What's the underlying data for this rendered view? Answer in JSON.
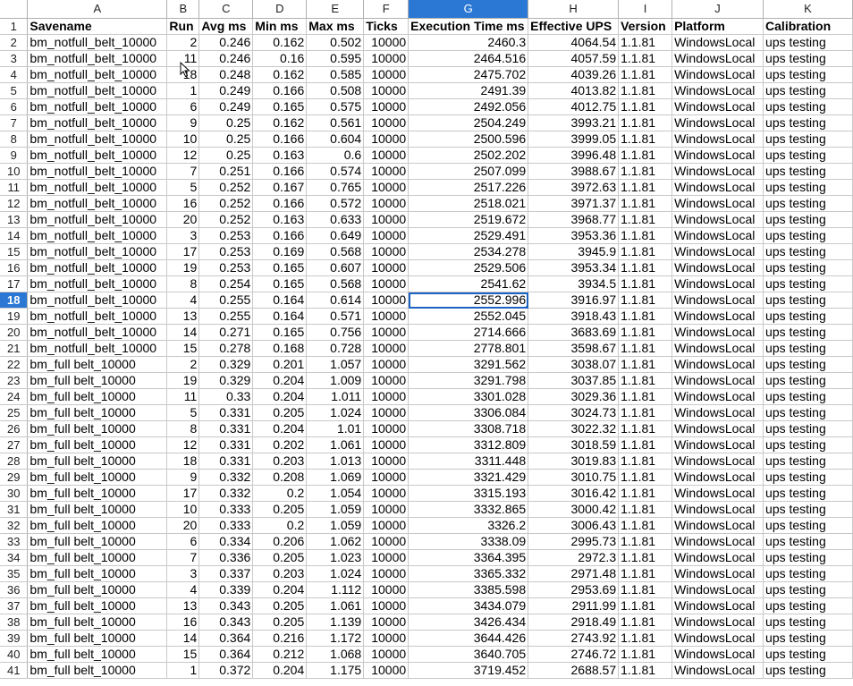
{
  "sheet": {
    "selected_cell": "G18",
    "selected_row": "18",
    "selected_col": "G",
    "columns": [
      "A",
      "B",
      "C",
      "D",
      "E",
      "F",
      "G",
      "H",
      "I",
      "J",
      "K"
    ],
    "col_align": [
      "txt",
      "num",
      "num",
      "num",
      "num",
      "num",
      "num",
      "num",
      "txt",
      "txt",
      "txt"
    ],
    "header_row": [
      "Savename",
      "Run",
      "Avg ms",
      "Min ms",
      "Max ms",
      "Ticks",
      "Execution Time ms",
      "Effective UPS",
      "Version",
      "Platform",
      "Calibration"
    ],
    "rows": [
      [
        "bm_notfull_belt_10000",
        "2",
        "0.246",
        "0.162",
        "0.502",
        "10000",
        "2460.3",
        "4064.54",
        "1.1.81",
        "WindowsLocal",
        "ups testing"
      ],
      [
        "bm_notfull_belt_10000",
        "11",
        "0.246",
        "0.16",
        "0.595",
        "10000",
        "2464.516",
        "4057.59",
        "1.1.81",
        "WindowsLocal",
        "ups testing"
      ],
      [
        "bm_notfull_belt_10000",
        "18",
        "0.248",
        "0.162",
        "0.585",
        "10000",
        "2475.702",
        "4039.26",
        "1.1.81",
        "WindowsLocal",
        "ups testing"
      ],
      [
        "bm_notfull_belt_10000",
        "1",
        "0.249",
        "0.166",
        "0.508",
        "10000",
        "2491.39",
        "4013.82",
        "1.1.81",
        "WindowsLocal",
        "ups testing"
      ],
      [
        "bm_notfull_belt_10000",
        "6",
        "0.249",
        "0.165",
        "0.575",
        "10000",
        "2492.056",
        "4012.75",
        "1.1.81",
        "WindowsLocal",
        "ups testing"
      ],
      [
        "bm_notfull_belt_10000",
        "9",
        "0.25",
        "0.162",
        "0.561",
        "10000",
        "2504.249",
        "3993.21",
        "1.1.81",
        "WindowsLocal",
        "ups testing"
      ],
      [
        "bm_notfull_belt_10000",
        "10",
        "0.25",
        "0.166",
        "0.604",
        "10000",
        "2500.596",
        "3999.05",
        "1.1.81",
        "WindowsLocal",
        "ups testing"
      ],
      [
        "bm_notfull_belt_10000",
        "12",
        "0.25",
        "0.163",
        "0.6",
        "10000",
        "2502.202",
        "3996.48",
        "1.1.81",
        "WindowsLocal",
        "ups testing"
      ],
      [
        "bm_notfull_belt_10000",
        "7",
        "0.251",
        "0.166",
        "0.574",
        "10000",
        "2507.099",
        "3988.67",
        "1.1.81",
        "WindowsLocal",
        "ups testing"
      ],
      [
        "bm_notfull_belt_10000",
        "5",
        "0.252",
        "0.167",
        "0.765",
        "10000",
        "2517.226",
        "3972.63",
        "1.1.81",
        "WindowsLocal",
        "ups testing"
      ],
      [
        "bm_notfull_belt_10000",
        "16",
        "0.252",
        "0.166",
        "0.572",
        "10000",
        "2518.021",
        "3971.37",
        "1.1.81",
        "WindowsLocal",
        "ups testing"
      ],
      [
        "bm_notfull_belt_10000",
        "20",
        "0.252",
        "0.163",
        "0.633",
        "10000",
        "2519.672",
        "3968.77",
        "1.1.81",
        "WindowsLocal",
        "ups testing"
      ],
      [
        "bm_notfull_belt_10000",
        "3",
        "0.253",
        "0.166",
        "0.649",
        "10000",
        "2529.491",
        "3953.36",
        "1.1.81",
        "WindowsLocal",
        "ups testing"
      ],
      [
        "bm_notfull_belt_10000",
        "17",
        "0.253",
        "0.169",
        "0.568",
        "10000",
        "2534.278",
        "3945.9",
        "1.1.81",
        "WindowsLocal",
        "ups testing"
      ],
      [
        "bm_notfull_belt_10000",
        "19",
        "0.253",
        "0.165",
        "0.607",
        "10000",
        "2529.506",
        "3953.34",
        "1.1.81",
        "WindowsLocal",
        "ups testing"
      ],
      [
        "bm_notfull_belt_10000",
        "8",
        "0.254",
        "0.165",
        "0.568",
        "10000",
        "2541.62",
        "3934.5",
        "1.1.81",
        "WindowsLocal",
        "ups testing"
      ],
      [
        "bm_notfull_belt_10000",
        "4",
        "0.255",
        "0.164",
        "0.614",
        "10000",
        "2552.996",
        "3916.97",
        "1.1.81",
        "WindowsLocal",
        "ups testing"
      ],
      [
        "bm_notfull_belt_10000",
        "13",
        "0.255",
        "0.164",
        "0.571",
        "10000",
        "2552.045",
        "3918.43",
        "1.1.81",
        "WindowsLocal",
        "ups testing"
      ],
      [
        "bm_notfull_belt_10000",
        "14",
        "0.271",
        "0.165",
        "0.756",
        "10000",
        "2714.666",
        "3683.69",
        "1.1.81",
        "WindowsLocal",
        "ups testing"
      ],
      [
        "bm_notfull_belt_10000",
        "15",
        "0.278",
        "0.168",
        "0.728",
        "10000",
        "2778.801",
        "3598.67",
        "1.1.81",
        "WindowsLocal",
        "ups testing"
      ],
      [
        "bm_full belt_10000",
        "2",
        "0.329",
        "0.201",
        "1.057",
        "10000",
        "3291.562",
        "3038.07",
        "1.1.81",
        "WindowsLocal",
        "ups testing"
      ],
      [
        "bm_full belt_10000",
        "19",
        "0.329",
        "0.204",
        "1.009",
        "10000",
        "3291.798",
        "3037.85",
        "1.1.81",
        "WindowsLocal",
        "ups testing"
      ],
      [
        "bm_full belt_10000",
        "11",
        "0.33",
        "0.204",
        "1.011",
        "10000",
        "3301.028",
        "3029.36",
        "1.1.81",
        "WindowsLocal",
        "ups testing"
      ],
      [
        "bm_full belt_10000",
        "5",
        "0.331",
        "0.205",
        "1.024",
        "10000",
        "3306.084",
        "3024.73",
        "1.1.81",
        "WindowsLocal",
        "ups testing"
      ],
      [
        "bm_full belt_10000",
        "8",
        "0.331",
        "0.204",
        "1.01",
        "10000",
        "3308.718",
        "3022.32",
        "1.1.81",
        "WindowsLocal",
        "ups testing"
      ],
      [
        "bm_full belt_10000",
        "12",
        "0.331",
        "0.202",
        "1.061",
        "10000",
        "3312.809",
        "3018.59",
        "1.1.81",
        "WindowsLocal",
        "ups testing"
      ],
      [
        "bm_full belt_10000",
        "18",
        "0.331",
        "0.203",
        "1.013",
        "10000",
        "3311.448",
        "3019.83",
        "1.1.81",
        "WindowsLocal",
        "ups testing"
      ],
      [
        "bm_full belt_10000",
        "9",
        "0.332",
        "0.208",
        "1.069",
        "10000",
        "3321.429",
        "3010.75",
        "1.1.81",
        "WindowsLocal",
        "ups testing"
      ],
      [
        "bm_full belt_10000",
        "17",
        "0.332",
        "0.2",
        "1.054",
        "10000",
        "3315.193",
        "3016.42",
        "1.1.81",
        "WindowsLocal",
        "ups testing"
      ],
      [
        "bm_full belt_10000",
        "10",
        "0.333",
        "0.205",
        "1.059",
        "10000",
        "3332.865",
        "3000.42",
        "1.1.81",
        "WindowsLocal",
        "ups testing"
      ],
      [
        "bm_full belt_10000",
        "20",
        "0.333",
        "0.2",
        "1.059",
        "10000",
        "3326.2",
        "3006.43",
        "1.1.81",
        "WindowsLocal",
        "ups testing"
      ],
      [
        "bm_full belt_10000",
        "6",
        "0.334",
        "0.206",
        "1.062",
        "10000",
        "3338.09",
        "2995.73",
        "1.1.81",
        "WindowsLocal",
        "ups testing"
      ],
      [
        "bm_full belt_10000",
        "7",
        "0.336",
        "0.205",
        "1.023",
        "10000",
        "3364.395",
        "2972.3",
        "1.1.81",
        "WindowsLocal",
        "ups testing"
      ],
      [
        "bm_full belt_10000",
        "3",
        "0.337",
        "0.203",
        "1.024",
        "10000",
        "3365.332",
        "2971.48",
        "1.1.81",
        "WindowsLocal",
        "ups testing"
      ],
      [
        "bm_full belt_10000",
        "4",
        "0.339",
        "0.204",
        "1.112",
        "10000",
        "3385.598",
        "2953.69",
        "1.1.81",
        "WindowsLocal",
        "ups testing"
      ],
      [
        "bm_full belt_10000",
        "13",
        "0.343",
        "0.205",
        "1.061",
        "10000",
        "3434.079",
        "2911.99",
        "1.1.81",
        "WindowsLocal",
        "ups testing"
      ],
      [
        "bm_full belt_10000",
        "16",
        "0.343",
        "0.205",
        "1.139",
        "10000",
        "3426.434",
        "2918.49",
        "1.1.81",
        "WindowsLocal",
        "ups testing"
      ],
      [
        "bm_full belt_10000",
        "14",
        "0.364",
        "0.216",
        "1.172",
        "10000",
        "3644.426",
        "2743.92",
        "1.1.81",
        "WindowsLocal",
        "ups testing"
      ],
      [
        "bm_full belt_10000",
        "15",
        "0.364",
        "0.212",
        "1.068",
        "10000",
        "3640.705",
        "2746.72",
        "1.1.81",
        "WindowsLocal",
        "ups testing"
      ],
      [
        "bm_full belt_10000",
        "1",
        "0.372",
        "0.204",
        "1.175",
        "10000",
        "3719.452",
        "2688.57",
        "1.1.81",
        "WindowsLocal",
        "ups testing"
      ]
    ]
  },
  "colors": {
    "selection": "#2a78d4",
    "grid": "#c8c8c8"
  }
}
